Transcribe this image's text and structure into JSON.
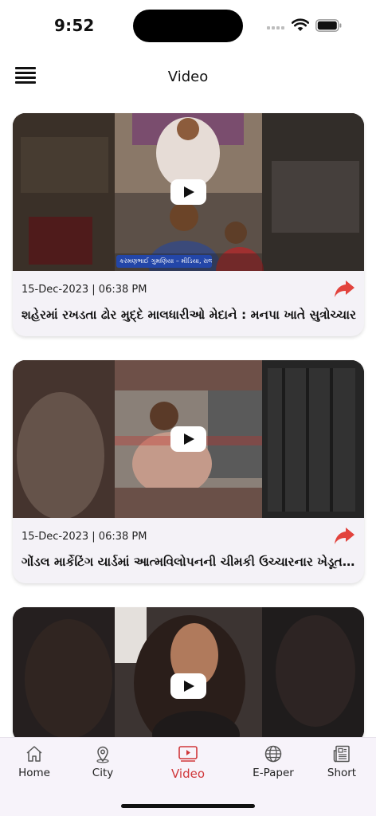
{
  "status_bar": {
    "time": "9:52"
  },
  "header": {
    "title": "Video",
    "menu_icon": "hamburger-menu-icon"
  },
  "videos": [
    {
      "date": "15-Dec-2023 | 06:38 PM",
      "title": "શહેરમાં રખડતા ઢોર મુદ્દે માલધારીઓ મેદાને : મનપા ખાતે સુત્રોચ્ચાર",
      "overlay_caption": "કરમણભાઈ ગુમણિયા – મીડિયા, રાજકોટ"
    },
    {
      "date": "15-Dec-2023 | 06:38 PM",
      "title": "ગોંડલ માર્કેટિંગ યાર્ડમાં આત્મવિલોપનની ચીમકી ઉચ્ચારનાર ખેડૂતની અટકાયત"
    },
    {
      "date": "",
      "title": ""
    }
  ],
  "bottom_nav": {
    "items": [
      {
        "label": "Home",
        "icon": "home-icon",
        "active": false
      },
      {
        "label": "City",
        "icon": "location-pin-icon",
        "active": false
      },
      {
        "label": "Video",
        "icon": "video-play-icon",
        "active": true
      },
      {
        "label": "E-Paper",
        "icon": "globe-icon",
        "active": false
      },
      {
        "label": "Short",
        "icon": "newspaper-icon",
        "active": false
      }
    ]
  },
  "colors": {
    "accent": "#d0373a",
    "share": "#e2433d",
    "card_bg": "#f4f2f7",
    "nav_bg": "#f7f3fa"
  }
}
